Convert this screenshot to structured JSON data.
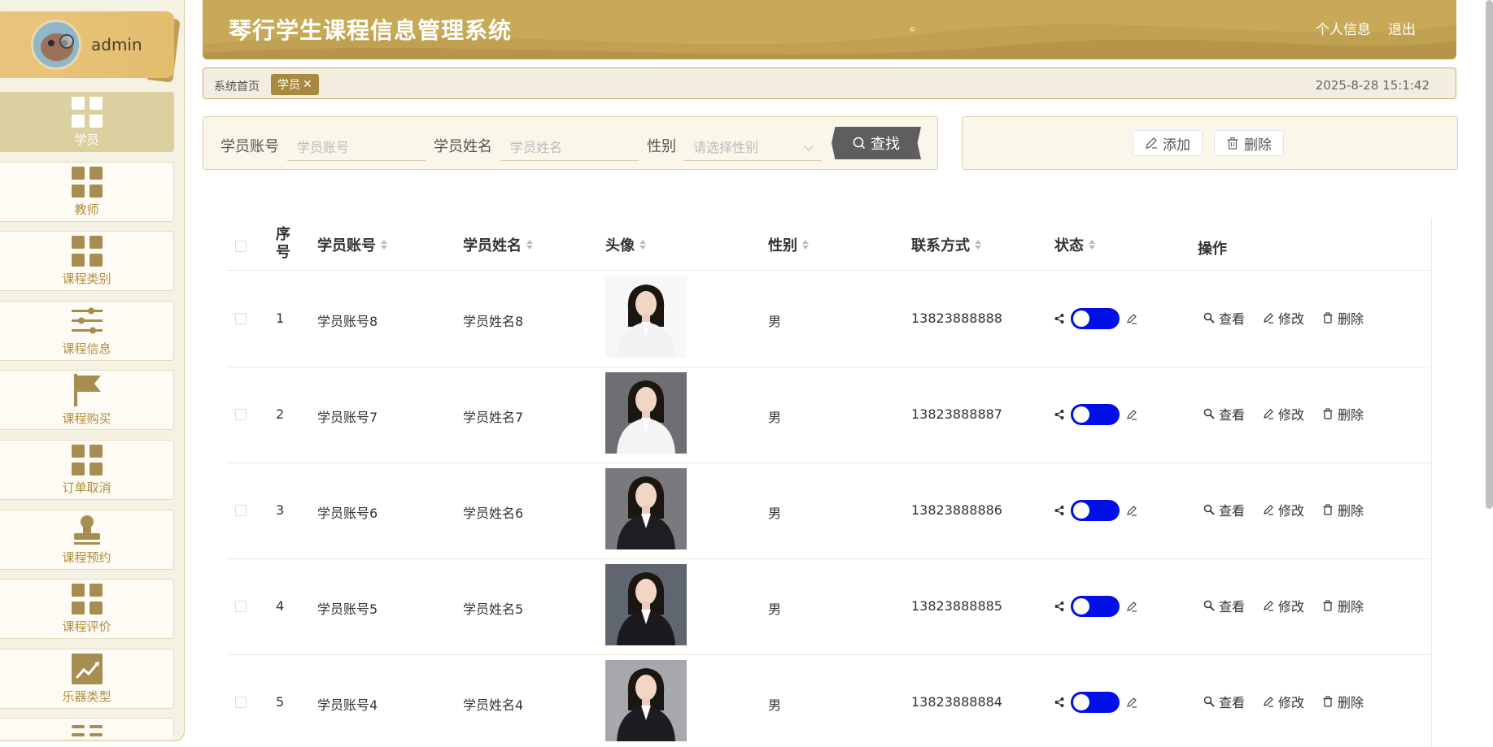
{
  "user": {
    "name": "admin"
  },
  "menu": [
    {
      "label": "学员",
      "icon": "grid-icon",
      "active": true
    },
    {
      "label": "教师",
      "icon": "grid-icon"
    },
    {
      "label": "课程类别",
      "icon": "grid-icon"
    },
    {
      "label": "课程信息",
      "icon": "sliders-icon"
    },
    {
      "label": "课程购买",
      "icon": "flag-icon"
    },
    {
      "label": "订单取消",
      "icon": "grid-icon"
    },
    {
      "label": "课程预约",
      "icon": "stamp-icon"
    },
    {
      "label": "课程评价",
      "icon": "grid-icon"
    },
    {
      "label": "乐器类型",
      "icon": "chart-icon"
    }
  ],
  "header": {
    "title": "琴行学生课程信息管理系统",
    "mark": "。",
    "profile_link": "个人信息",
    "logout_link": "退出"
  },
  "tags": {
    "home": "系统首页",
    "active_tag": "学员",
    "close": "✕",
    "datetime": "2025-8-28 15:1:42"
  },
  "search": {
    "account_label": "学员账号",
    "account_placeholder": "学员账号",
    "name_label": "学员姓名",
    "name_placeholder": "学员姓名",
    "gender_label": "性别",
    "gender_placeholder": "请选择性别",
    "search_button": "查找"
  },
  "actions": {
    "add": "添加",
    "delete": "删除"
  },
  "table": {
    "headers": {
      "index": "序号",
      "account": "学员账号",
      "name": "学员姓名",
      "avatar": "头像",
      "gender": "性别",
      "phone": "联系方式",
      "status": "状态",
      "ops": "操作"
    },
    "op_labels": {
      "view": "查看",
      "edit": "修改",
      "delete": "删除"
    },
    "rows": [
      {
        "index": "1",
        "account": "学员账号8",
        "name": "学员姓名8",
        "gender": "男",
        "phone": "13823888888"
      },
      {
        "index": "2",
        "account": "学员账号7",
        "name": "学员姓名7",
        "gender": "男",
        "phone": "13823888887"
      },
      {
        "index": "3",
        "account": "学员账号6",
        "name": "学员姓名6",
        "gender": "男",
        "phone": "13823888886"
      },
      {
        "index": "4",
        "account": "学员账号5",
        "name": "学员姓名5",
        "gender": "男",
        "phone": "13823888885"
      },
      {
        "index": "5",
        "account": "学员账号4",
        "name": "学员姓名4",
        "gender": "男",
        "phone": "13823888884"
      }
    ]
  },
  "colors": {
    "accent": "#c8a958",
    "toggle_on": "#0010e6",
    "menu_icon": "#a88d52",
    "menu_text": "#b28e3d"
  }
}
